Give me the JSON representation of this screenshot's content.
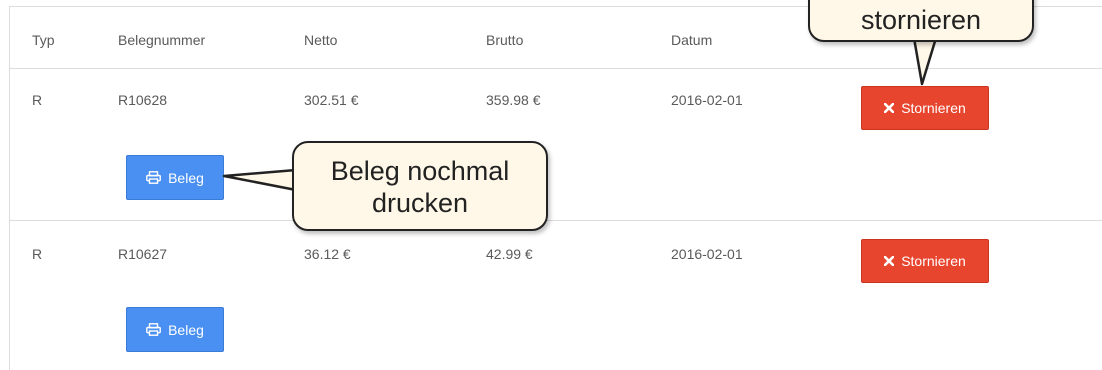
{
  "table": {
    "headers": {
      "typ": "Typ",
      "belegnummer": "Belegnummer",
      "netto": "Netto",
      "brutto": "Brutto",
      "datum": "Datum"
    },
    "rows": [
      {
        "typ": "R",
        "belegnummer": "R10628",
        "netto": "302.51 €",
        "brutto": "359.98 €",
        "datum": "2016-02-01",
        "storno_label": "Stornieren",
        "beleg_label": "Beleg"
      },
      {
        "typ": "R",
        "belegnummer": "R10627",
        "netto": "36.12 €",
        "brutto": "42.99 €",
        "datum": "2016-02-01",
        "storno_label": "Stornieren",
        "beleg_label": "Beleg"
      }
    ]
  },
  "callouts": {
    "storno": "stornieren",
    "beleg_line1": "Beleg nochmal",
    "beleg_line2": "drucken"
  },
  "icons": {
    "storno": "times-icon",
    "beleg": "print-icon"
  },
  "colors": {
    "storno_button": "#e8452f",
    "beleg_button": "#4a90f2",
    "callout_fill": "#fff8e8",
    "grid_line": "#dcdcdc"
  }
}
